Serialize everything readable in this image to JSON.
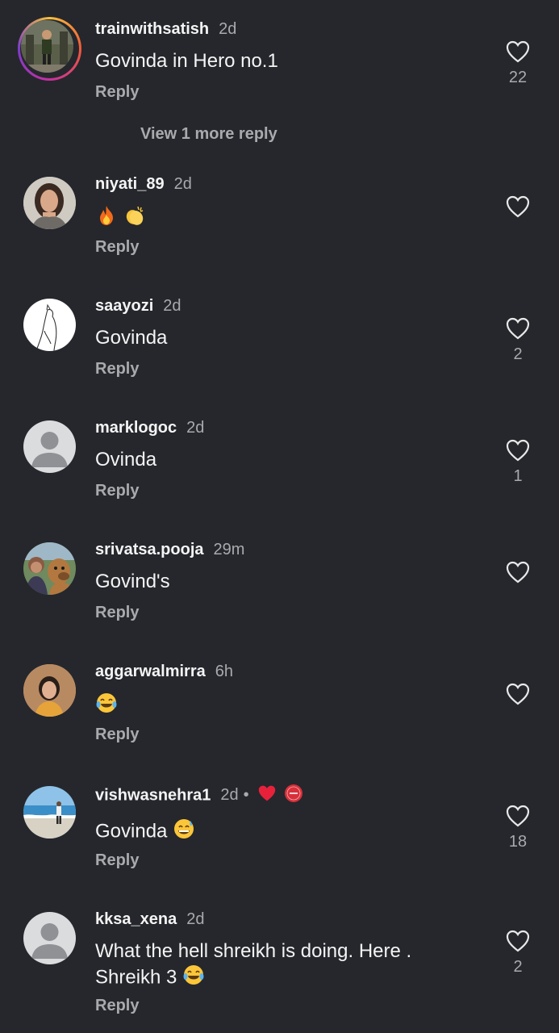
{
  "colors": {
    "background": "#25272c",
    "primary_text": "#f4f4f4",
    "secondary_text": "#a8aaad",
    "heart_badge": "#e8213b"
  },
  "comments": [
    {
      "username": "trainwithsatish",
      "time": "2d",
      "text": "Govinda in Hero no.1",
      "reply_label": "Reply",
      "likes": "22",
      "avatar": "gym-photo",
      "view_more": "View 1 more reply"
    },
    {
      "username": "niyati_89",
      "time": "2d",
      "text": "",
      "emojis": [
        "fire-emoji",
        "clapping-hands-emoji"
      ],
      "reply_label": "Reply",
      "likes": "",
      "avatar": "woman-photo"
    },
    {
      "username": "saayozi",
      "time": "2d",
      "text": "Govinda",
      "reply_label": "Reply",
      "likes": "2",
      "avatar": "line-art-cat"
    },
    {
      "username": "marklogoc",
      "time": "2d",
      "text": "Ovinda",
      "reply_label": "Reply",
      "likes": "1",
      "avatar": "default-avatar"
    },
    {
      "username": "srivatsa.pooja",
      "time": "29m",
      "text": "Govind's",
      "reply_label": "Reply",
      "likes": "",
      "avatar": "woman-with-dog-photo"
    },
    {
      "username": "aggarwalmirra",
      "time": "6h",
      "text": "",
      "emojis": [
        "tears-of-joy-emoji"
      ],
      "reply_label": "Reply",
      "likes": "",
      "avatar": "woman-portrait-photo"
    },
    {
      "username": "vishwasnehra1",
      "time": "2d",
      "separator": "•",
      "badges": [
        "red-heart-badge",
        "creator-badge"
      ],
      "text": "Govinda",
      "emojis": [
        "grinning-sweat-emoji"
      ],
      "reply_label": "Reply",
      "likes": "18",
      "avatar": "beach-photo"
    },
    {
      "username": "kksa_xena",
      "time": "2d",
      "text_line1": "What the hell shreikh is doing. Here .",
      "text_line2": "Shreikh 3",
      "emojis": [
        "tears-of-joy-emoji"
      ],
      "reply_label": "Reply",
      "likes": "2",
      "avatar": "default-avatar"
    }
  ]
}
